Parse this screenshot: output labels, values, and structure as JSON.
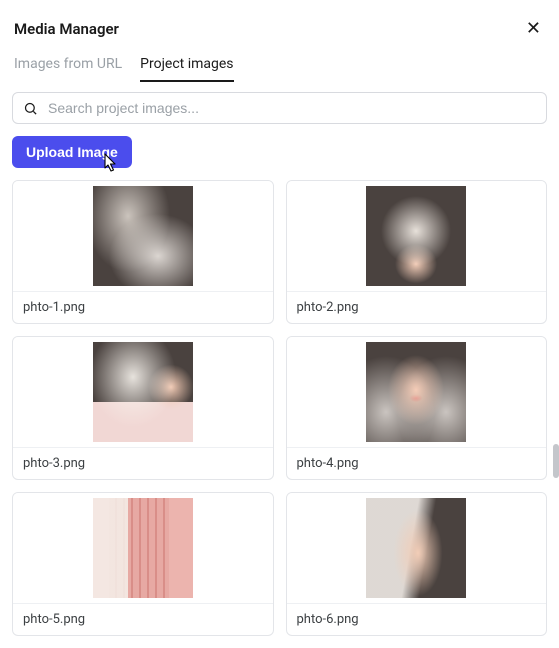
{
  "header": {
    "title": "Media Manager",
    "close_glyph": "✕"
  },
  "tabs": [
    {
      "label": "Images from URL",
      "active": false
    },
    {
      "label": "Project images",
      "active": true
    }
  ],
  "search": {
    "placeholder": "Search project images..."
  },
  "actions": {
    "upload_label": "Upload Image"
  },
  "images": [
    {
      "filename": "phto-1.png"
    },
    {
      "filename": "phto-2.png"
    },
    {
      "filename": "phto-3.png"
    },
    {
      "filename": "phto-4.png"
    },
    {
      "filename": "phto-5.png"
    },
    {
      "filename": "phto-6.png"
    }
  ]
}
